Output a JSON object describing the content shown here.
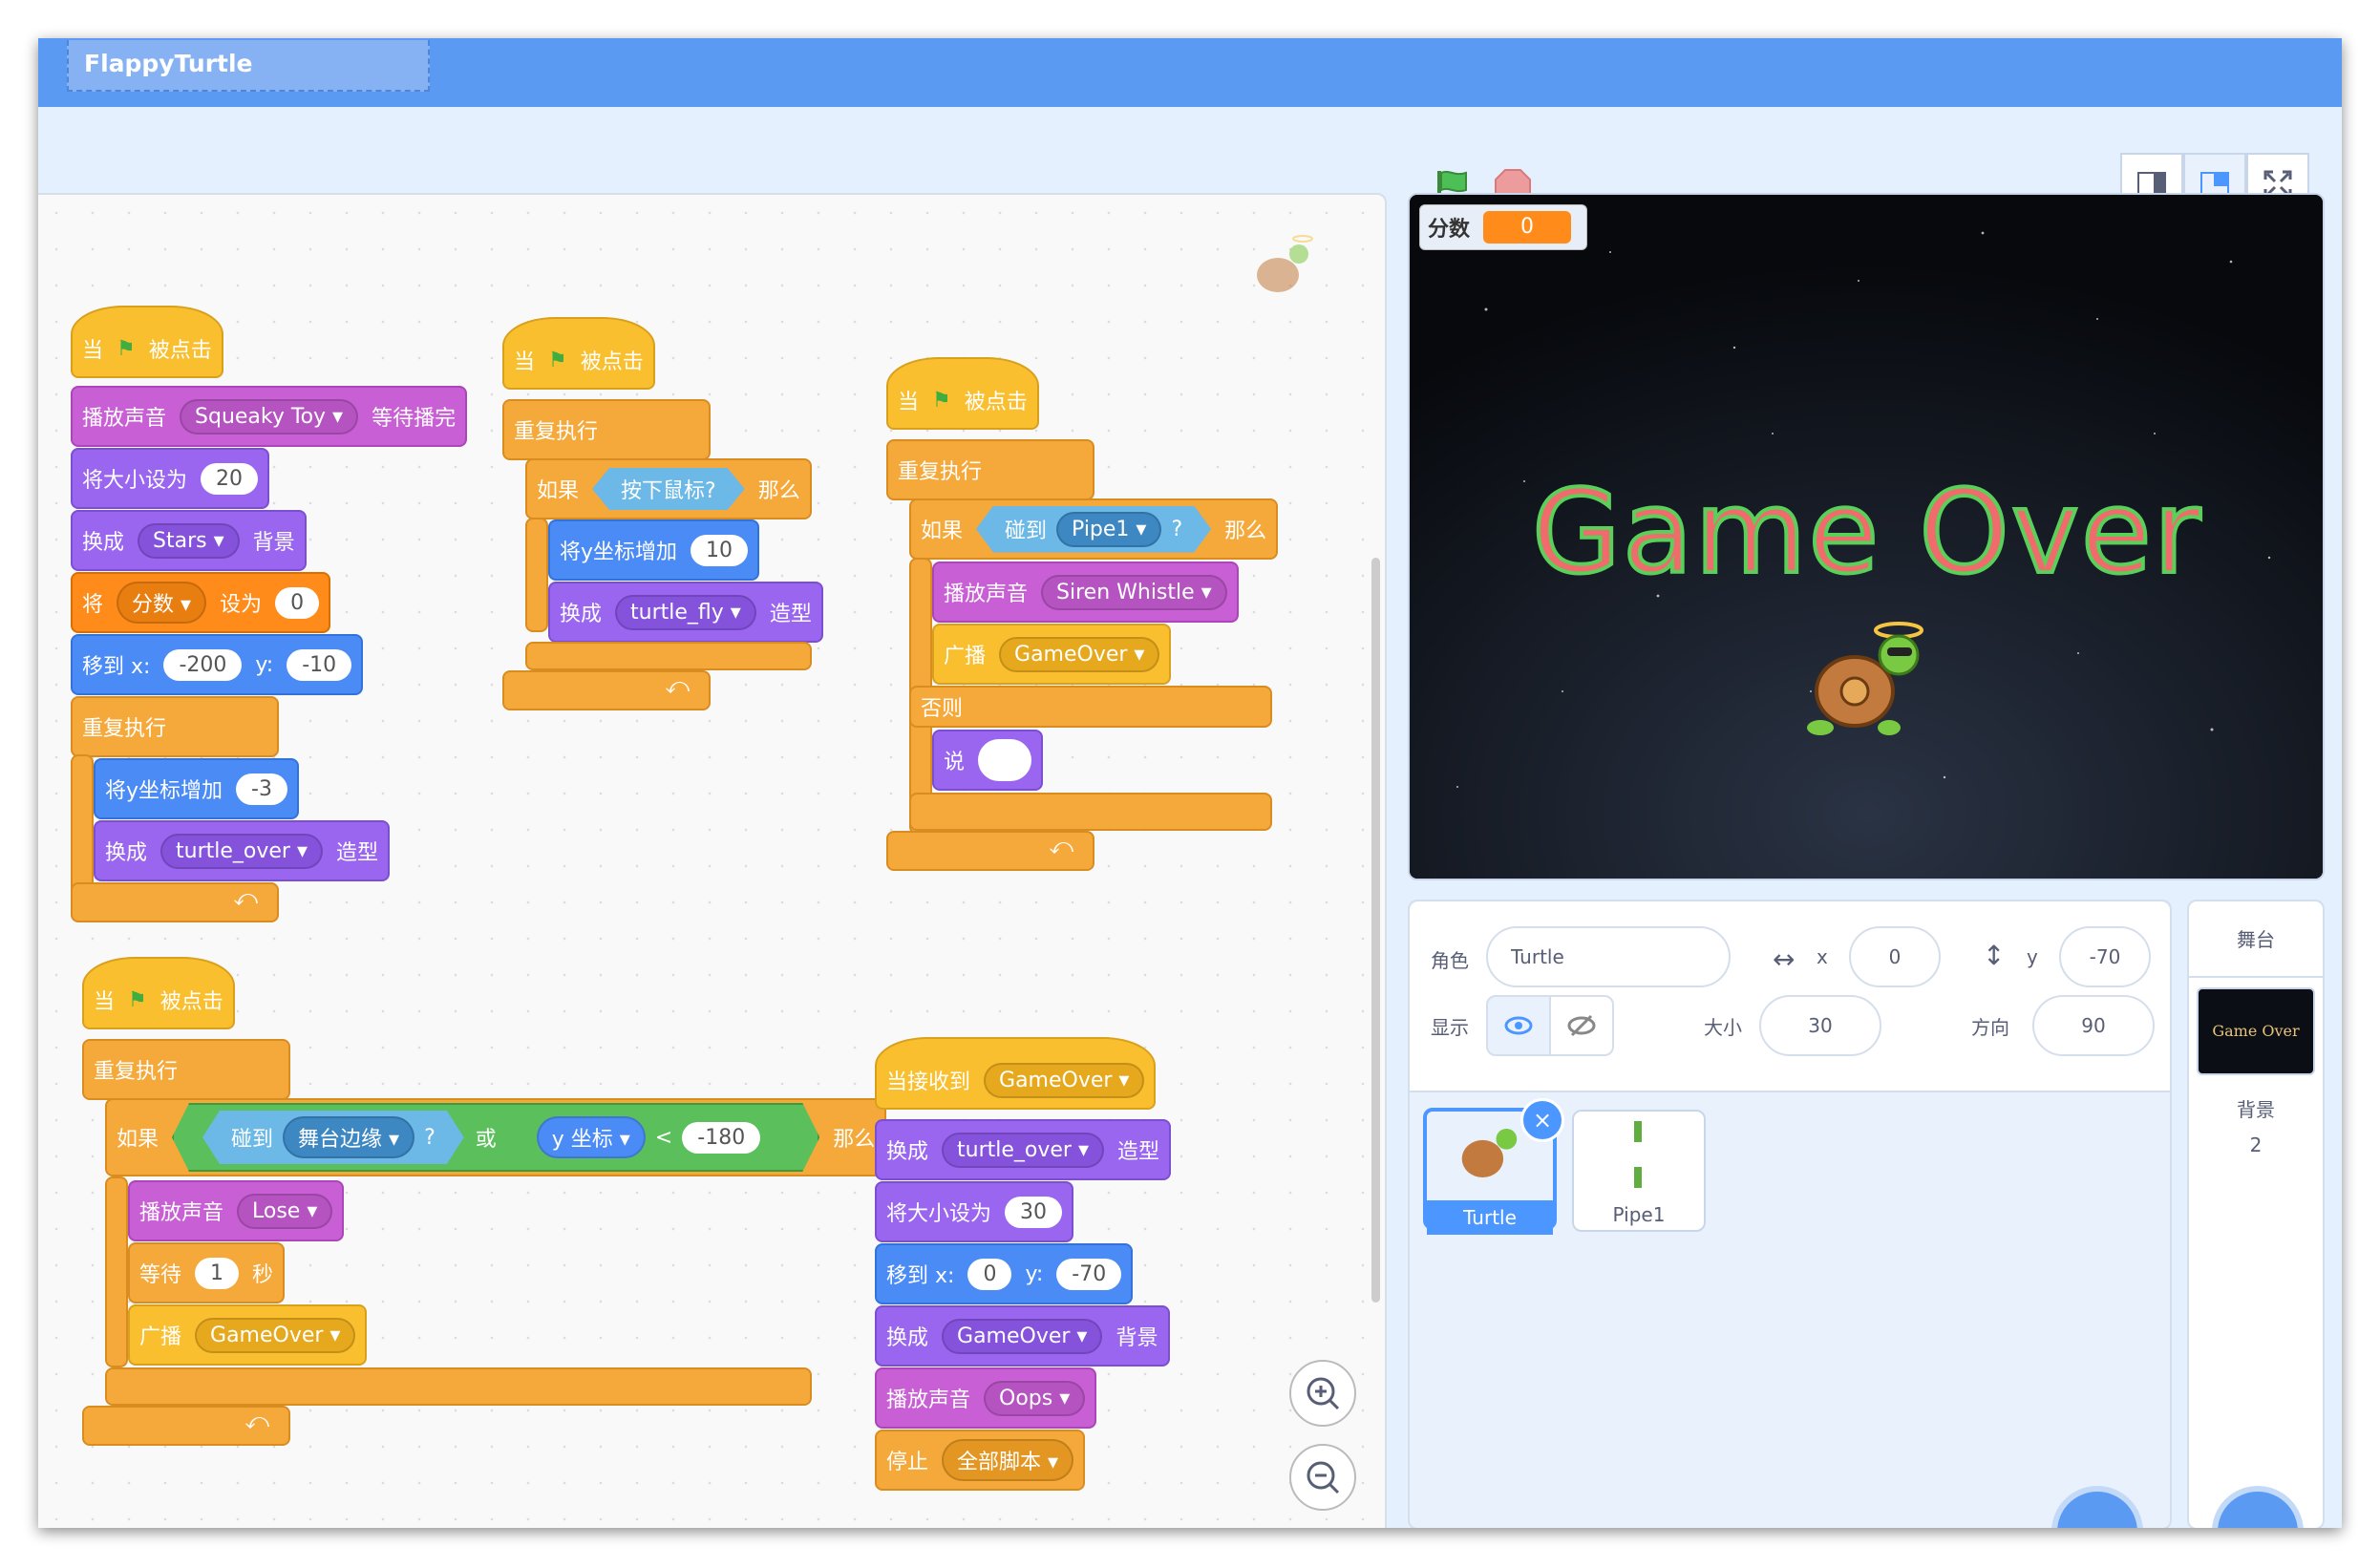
{
  "app": {
    "title": "FlappyTurtle"
  },
  "toolbar": {
    "view_modes": [
      "small-stage-icon",
      "normal-stage-icon",
      "fullscreen-icon"
    ],
    "flag": "green-flag-icon",
    "stop": "stop-icon"
  },
  "colors": {
    "topbar": "#5b9af2",
    "events": "#f9bf2e",
    "sound": "#c85fd4",
    "looks": "#9a66f0",
    "motion": "#4b8bf5",
    "control": "#f5a93b",
    "variables": "#ff8c1a",
    "sensing": "#55a3d6",
    "operators": "#5bc05b"
  },
  "scripts": {
    "s1": {
      "when": "当",
      "clicked": "被点击",
      "play_sound": "播放声音",
      "sound": "Squeaky Toy",
      "until_done": "等待播完",
      "set_size": "将大小设为",
      "size": "20",
      "switch": "换成",
      "backdrop": "Stars",
      "backdrop_word": "背景",
      "set": "将",
      "var": "分数",
      "set_to": "设为",
      "var_val": "0",
      "goto": "移到 x:",
      "x": "-200",
      "y_label": "y:",
      "y": "-10",
      "forever": "重复执行",
      "change_y": "将y坐标增加",
      "dy": "-3",
      "switch2": "换成",
      "costume": "turtle_over",
      "costume_word": "造型"
    },
    "s2": {
      "when": "当",
      "clicked": "被点击",
      "forever": "重复执行",
      "if": "如果",
      "mouse": "按下鼠标?",
      "then": "那么",
      "change_y": "将y坐标增加",
      "dy": "10",
      "switch": "换成",
      "costume": "turtle_fly",
      "costume_word": "造型"
    },
    "s3": {
      "when": "当",
      "clicked": "被点击",
      "forever": "重复执行",
      "if": "如果",
      "touch": "碰到",
      "target": "Pipe1",
      "q": "?",
      "then": "那么",
      "play_sound": "播放声音",
      "sound": "Siren Whistle",
      "broadcast": "广播",
      "msg": "GameOver",
      "else": "否则",
      "say": "说"
    },
    "s4": {
      "when": "当",
      "clicked": "被点击",
      "forever": "重复执行",
      "if": "如果",
      "touch": "碰到",
      "target": "舞台边缘",
      "q": "?",
      "or": "或",
      "ypos": "y 坐标",
      "lt": "<",
      "val": "-180",
      "then": "那么",
      "play_sound": "播放声音",
      "sound": "Lose",
      "wait": "等待",
      "secs": "1",
      "sec_word": "秒",
      "broadcast": "广播",
      "msg": "GameOver"
    },
    "s5": {
      "receive": "当接收到",
      "msg": "GameOver",
      "switch": "换成",
      "costume": "turtle_over",
      "costume_word": "造型",
      "set_size": "将大小设为",
      "size": "30",
      "goto": "移到 x:",
      "x": "0",
      "y_label": "y:",
      "y": "-70",
      "switch2": "换成",
      "backdrop": "GameOver",
      "backdrop_word": "背景",
      "play_sound": "播放声音",
      "sound": "Oops",
      "stop": "停止",
      "stop_opt": "全部脚本"
    }
  },
  "stage": {
    "monitor_label": "分数",
    "monitor_value": "0",
    "game_over_text": "Game Over"
  },
  "sprite": {
    "label": "角色",
    "name": "Turtle",
    "x_label": "x",
    "x": "0",
    "y_label": "y",
    "y": "-70",
    "show_label": "显示",
    "size_label": "大小",
    "size": "30",
    "dir_label": "方向",
    "direction": "90"
  },
  "sprites": [
    {
      "name": "Turtle"
    },
    {
      "name": "Pipe1"
    }
  ],
  "stage_pane": {
    "title": "舞台",
    "thumb_text": "Game Over",
    "backdrops_label": "背景",
    "backdrops_count": "2"
  }
}
